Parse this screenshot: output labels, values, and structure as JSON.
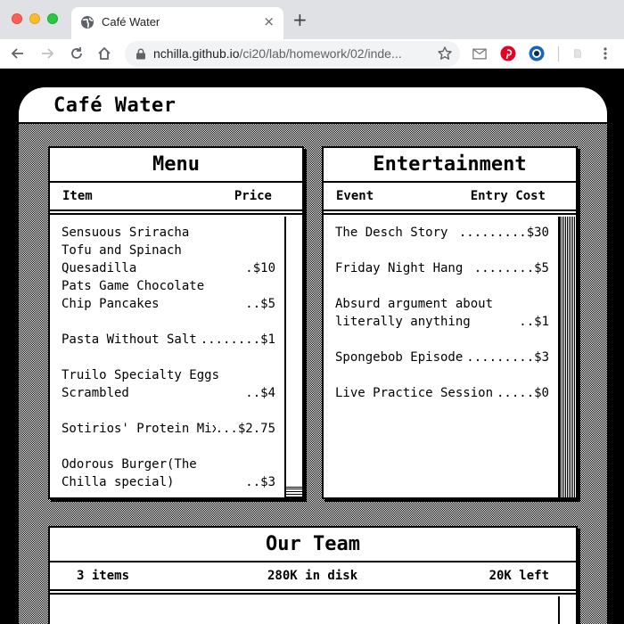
{
  "browser": {
    "tab_title": "Café Water",
    "tab_close": "×",
    "new_tab": "+",
    "url_host": "nchilla.github.io",
    "url_path": "/ci20/lab/homework/02/inde..."
  },
  "window": {
    "title": "Café Water"
  },
  "menu": {
    "title": "Menu",
    "col_item": "Item",
    "col_price": "Price",
    "items": [
      {
        "name": "Sensuous Sriracha Tofu and Spinach Quesadilla",
        "price": ".$10"
      },
      {
        "name": "Pats Game Chocolate Chip Pancakes",
        "price": "..$5"
      },
      {
        "name": "Pasta Without Salt",
        "price": "........$1"
      },
      {
        "name": "Truilo Specialty Eggs Scrambled",
        "price": "..$4"
      },
      {
        "name": "Sotirios' Protein Mix",
        "price": "...$2.75"
      },
      {
        "name": "Odorous Burger(The Chilla special)",
        "price": "..$3"
      }
    ]
  },
  "entertainment": {
    "title": "Entertainment",
    "col_event": "Event",
    "col_cost": "Entry Cost",
    "items": [
      {
        "name": "The Desch Story",
        "price": ".........$30"
      },
      {
        "name": "Friday Night Hang",
        "price": "........$5"
      },
      {
        "name": "Absurd argument about literally anything",
        "price": "..$1"
      },
      {
        "name": "Spongebob Episode",
        "price": ".........$3"
      },
      {
        "name": "Live Practice Session",
        "price": ".....$0"
      }
    ]
  },
  "team": {
    "title": "Our Team",
    "items_count": "3 items",
    "disk": "280K in disk",
    "left": "20K left"
  }
}
